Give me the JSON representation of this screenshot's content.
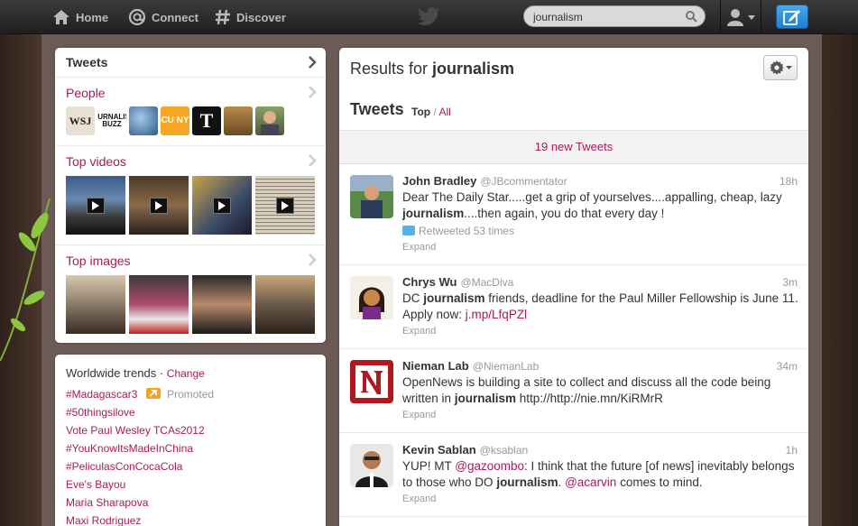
{
  "nav": {
    "home": "Home",
    "connect": "Connect",
    "discover": "Discover"
  },
  "search": {
    "value": "journalism"
  },
  "left": {
    "tweets_label": "Tweets",
    "people_label": "People",
    "videos_label": "Top videos",
    "images_label": "Top images",
    "people_avatars": [
      "WSJ",
      "JOURNALISM BUZZ",
      "",
      "CU NY",
      "T",
      "",
      ""
    ]
  },
  "trends": {
    "title": "Worldwide trends",
    "separator": "·",
    "change": "Change",
    "promoted": "Promoted",
    "items": [
      "#Madagascar3",
      "#50thingsilove",
      "Vote Paul Wesley TCAs2012",
      "#YouKnowItsMadeInChina",
      "#PeliculasConCocaCola",
      "Eve's Bayou",
      "Maria Sharapova",
      "Maxi Rodriguez"
    ]
  },
  "main": {
    "results_prefix": "Results for",
    "query": "journalism",
    "tweets_header": "Tweets",
    "filter_top": "Top",
    "filter_sep": "/",
    "filter_all": "All",
    "new_tweets": "19 new Tweets",
    "expand": "Expand"
  },
  "tweets": [
    {
      "name": "John Bradley",
      "handle": "@JBcommentator",
      "time": "18h",
      "text_1": "Dear The Daily Star.....get a grip of yourselves....appalling, cheap, lazy ",
      "bold": "journalism",
      "text_2": "....then again, you do that every day !",
      "retweets": "Retweeted 53 times"
    },
    {
      "name": "Chrys Wu",
      "handle": "@MacDiva",
      "time": "3m",
      "text_1": "DC ",
      "bold": "journalism",
      "text_2": " friends, deadline for the Paul Miller Fellowship is June 11. Apply now: ",
      "link": "j.mp/LfqPZl"
    },
    {
      "name": "Nieman Lab",
      "handle": "@NiemanLab",
      "time": "34m",
      "text_1": "OpenNews is building a site to collect and discuss all the code being written in ",
      "bold": "journalism",
      "text_2": " http://http://nie.mn/KiRMrR"
    },
    {
      "name": "Kevin Sablan",
      "handle": "@ksablan",
      "time": "1h",
      "text_1": "YUP! MT ",
      "mention_1": "@gazoombo",
      "text_2": ": I think that the future [of news] inevitably belongs to those who DO ",
      "bold": "journalism",
      "text_3": ". ",
      "mention_2": "@acarvin",
      "text_4": " comes to mind."
    }
  ],
  "colors": {
    "accent": "#b0185a",
    "topbar": "#2a2a2a",
    "compose": "#2b8fe0"
  }
}
